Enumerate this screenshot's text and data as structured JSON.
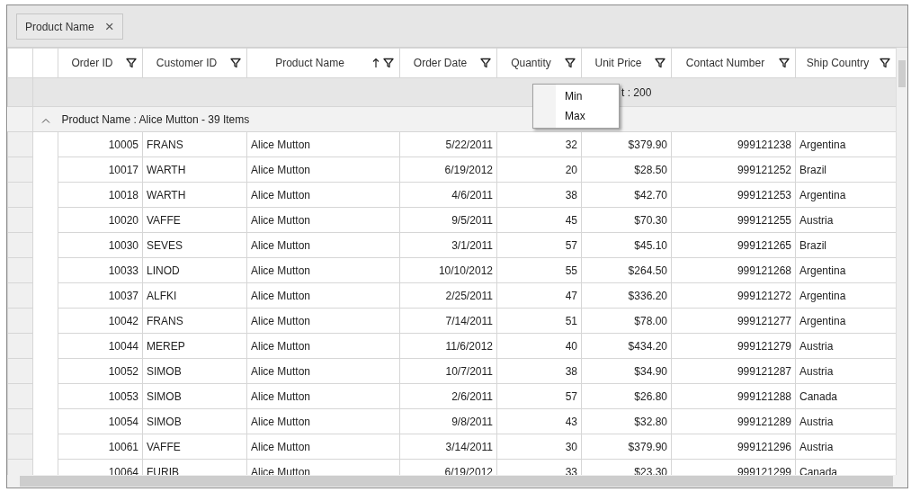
{
  "group_drop_area": {
    "chips": [
      {
        "label": "Product Name",
        "close": "×"
      }
    ]
  },
  "columns": [
    {
      "label": "Order ID",
      "sorted": false
    },
    {
      "label": "Customer ID",
      "sorted": false
    },
    {
      "label": "Product Name",
      "sorted": true
    },
    {
      "label": "Order Date",
      "sorted": false
    },
    {
      "label": "Quantity",
      "sorted": false
    },
    {
      "label": "Unit Price",
      "sorted": false
    },
    {
      "label": "Contact Number",
      "sorted": false
    },
    {
      "label": "Ship Country",
      "sorted": false
    }
  ],
  "summary_row": {
    "text": "t : 200"
  },
  "group": {
    "caption": "Product Name : Alice Mutton - 39 Items",
    "expanded": true
  },
  "rows": [
    [
      "10005",
      "FRANS",
      "Alice Mutton",
      "5/22/2011",
      "32",
      "$379.90",
      "999121238",
      "Argentina"
    ],
    [
      "10017",
      "WARTH",
      "Alice Mutton",
      "6/19/2012",
      "20",
      "$28.50",
      "999121252",
      "Brazil"
    ],
    [
      "10018",
      "WARTH",
      "Alice Mutton",
      "4/6/2011",
      "38",
      "$42.70",
      "999121253",
      "Argentina"
    ],
    [
      "10020",
      "VAFFE",
      "Alice Mutton",
      "9/5/2011",
      "45",
      "$70.30",
      "999121255",
      "Austria"
    ],
    [
      "10030",
      "SEVES",
      "Alice Mutton",
      "3/1/2011",
      "57",
      "$45.10",
      "999121265",
      "Brazil"
    ],
    [
      "10033",
      "LINOD",
      "Alice Mutton",
      "10/10/2012",
      "55",
      "$264.50",
      "999121268",
      "Argentina"
    ],
    [
      "10037",
      "ALFKI",
      "Alice Mutton",
      "2/25/2011",
      "47",
      "$336.20",
      "999121272",
      "Argentina"
    ],
    [
      "10042",
      "FRANS",
      "Alice Mutton",
      "7/14/2011",
      "51",
      "$78.00",
      "999121277",
      "Argentina"
    ],
    [
      "10044",
      "MEREP",
      "Alice Mutton",
      "11/6/2012",
      "40",
      "$434.20",
      "999121279",
      "Austria"
    ],
    [
      "10052",
      "SIMOB",
      "Alice Mutton",
      "10/7/2011",
      "38",
      "$34.90",
      "999121287",
      "Austria"
    ],
    [
      "10053",
      "SIMOB",
      "Alice Mutton",
      "2/6/2011",
      "57",
      "$26.80",
      "999121288",
      "Canada"
    ],
    [
      "10054",
      "SIMOB",
      "Alice Mutton",
      "9/8/2011",
      "43",
      "$32.80",
      "999121289",
      "Austria"
    ],
    [
      "10061",
      "VAFFE",
      "Alice Mutton",
      "3/14/2011",
      "30",
      "$379.90",
      "999121296",
      "Austria"
    ],
    [
      "10064",
      "FURIB",
      "Alice Mutton",
      "6/19/2012",
      "33",
      "$23.30",
      "999121299",
      "Canada"
    ]
  ],
  "context_menu": {
    "items": [
      {
        "label": "Min"
      },
      {
        "label": "Max"
      }
    ]
  }
}
